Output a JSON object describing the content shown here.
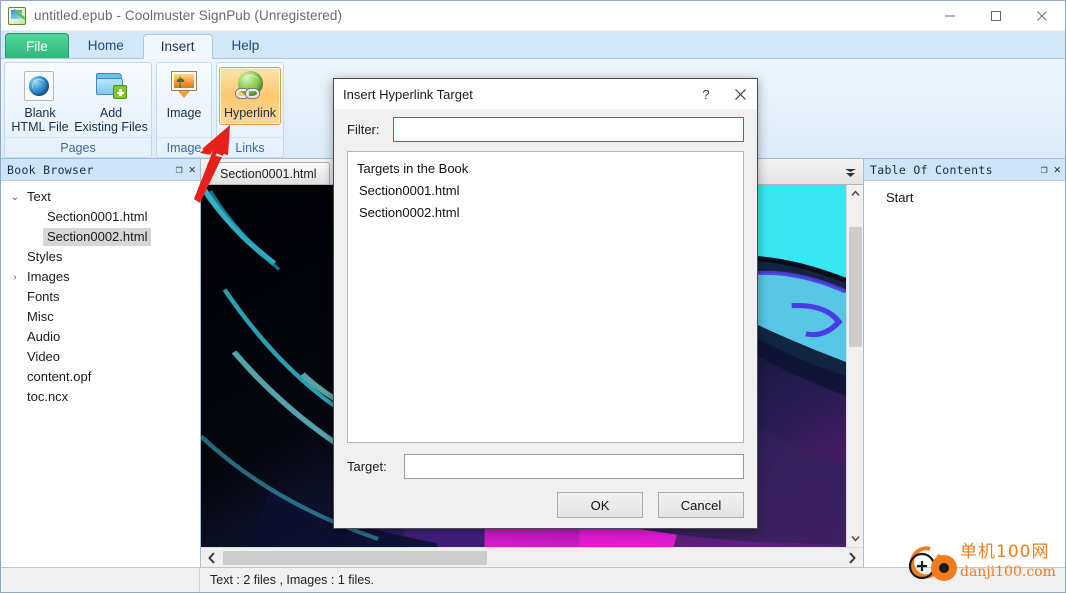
{
  "window": {
    "title": "untitled.epub - Coolmuster SignPub (Unregistered)",
    "icon": "app-epub-icon",
    "minimize": "—",
    "maximize": "☐",
    "close": "✕"
  },
  "ribbon": {
    "tabs": [
      {
        "label": "File",
        "kind": "file"
      },
      {
        "label": "Home",
        "kind": "normal"
      },
      {
        "label": "Insert",
        "kind": "active"
      },
      {
        "label": "Help",
        "kind": "normal"
      }
    ],
    "groups": [
      {
        "label": "Pages",
        "buttons": [
          {
            "label_line1": "Blank",
            "label_line2": "HTML File",
            "icon": "globe-icon",
            "selected": false
          },
          {
            "label_line1": "Add",
            "label_line2": "Existing Files",
            "icon": "add-folder-icon",
            "selected": false
          }
        ]
      },
      {
        "label": "Image",
        "buttons": [
          {
            "label_line1": "Image",
            "label_line2": "",
            "icon": "picture-icon",
            "selected": false
          }
        ]
      },
      {
        "label": "Links",
        "buttons": [
          {
            "label_line1": "Hyperlink",
            "label_line2": "",
            "icon": "hyperlink-icon",
            "selected": true
          }
        ]
      }
    ]
  },
  "book_browser": {
    "title": "Book Browser",
    "float_icon": "❐",
    "close_icon": "✕",
    "nodes": [
      {
        "label": "Text",
        "depth": 0,
        "twist": "⌄",
        "selected": false
      },
      {
        "label": "Section0001.html",
        "depth": 2,
        "twist": "",
        "selected": false
      },
      {
        "label": "Section0002.html",
        "depth": 2,
        "twist": "",
        "selected": true
      },
      {
        "label": "Styles",
        "depth": 1,
        "twist": "",
        "selected": false
      },
      {
        "label": "Images",
        "depth": 0,
        "twist": "›",
        "selected": false
      },
      {
        "label": "Fonts",
        "depth": 1,
        "twist": "",
        "selected": false
      },
      {
        "label": "Misc",
        "depth": 1,
        "twist": "",
        "selected": false
      },
      {
        "label": "Audio",
        "depth": 1,
        "twist": "",
        "selected": false
      },
      {
        "label": "Video",
        "depth": 1,
        "twist": "",
        "selected": false
      },
      {
        "label": "content.opf",
        "depth": 1,
        "twist": "",
        "selected": false
      },
      {
        "label": "toc.ncx",
        "depth": 1,
        "twist": "",
        "selected": false
      }
    ]
  },
  "editor": {
    "tab_label": "Section0001.html",
    "tab_menu_icon": "chevron-down-icon",
    "scroll_up_icon": "∧",
    "scroll_down_icon": "∨",
    "scroll_left_icon": "❮",
    "scroll_right_icon": "❯"
  },
  "toc": {
    "title": "Table Of Contents",
    "float_icon": "❐",
    "close_icon": "✕",
    "items": [
      {
        "label": "Start"
      }
    ]
  },
  "statusbar": {
    "text": "Text : 2 files , Images : 1 files."
  },
  "dialog": {
    "title": "Insert Hyperlink Target",
    "help_icon": "?",
    "close_icon": "✕",
    "filter_label": "Filter:",
    "filter_value": "",
    "filter_placeholder": "",
    "list_header": "Targets in the Book",
    "list_items": [
      "Section0001.html",
      "Section0002.html"
    ],
    "target_label": "Target:",
    "target_value": "",
    "target_placeholder": "",
    "ok_label": "OK",
    "cancel_label": "Cancel"
  },
  "annotation": {
    "arrow_color": "#e8201a",
    "arrow_name": "red-pointer-arrow"
  },
  "watermark": {
    "cn": "单机100网",
    "en": "danji100.com",
    "color": "#f07c1e"
  },
  "colors": {
    "ribbon_accent": "#2fb87c",
    "selected_button": "#ffc870",
    "dock_header": "#cfe4f7",
    "focus_border": "#1a7fd4"
  }
}
